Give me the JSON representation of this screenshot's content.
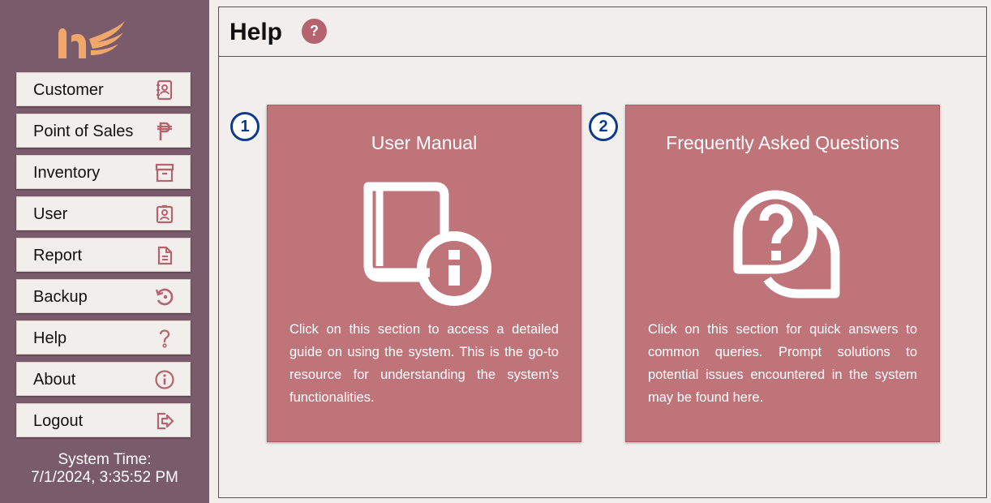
{
  "sidebar": {
    "logo_icon": "logo-icon",
    "items": [
      {
        "label": "Customer",
        "icon": "contact-book-icon"
      },
      {
        "label": "Point of Sales",
        "icon": "peso-icon"
      },
      {
        "label": "Inventory",
        "icon": "archive-box-icon"
      },
      {
        "label": "User",
        "icon": "user-badge-icon"
      },
      {
        "label": "Report",
        "icon": "document-icon"
      },
      {
        "label": "Backup",
        "icon": "history-icon"
      },
      {
        "label": "Help",
        "icon": "question-icon"
      },
      {
        "label": "About",
        "icon": "info-icon"
      },
      {
        "label": "Logout",
        "icon": "logout-icon"
      }
    ],
    "system_time_label": "System Time:",
    "system_time_value": "7/1/2024, 3:35:52 PM"
  },
  "header": {
    "title": "Help",
    "badge": "?"
  },
  "cards": [
    {
      "marker": "1",
      "title": "User Manual",
      "icon": "manual-book-icon",
      "description": "Click on this section to access a detailed guide on using the system. This is the go-to resource for understanding the system's functionalities."
    },
    {
      "marker": "2",
      "title": "Frequently Asked Questions",
      "icon": "faq-chat-icon",
      "description": "Click on this section for quick answers to common queries. Prompt solutions to potential issues encountered in the system may be found here."
    }
  ],
  "colors": {
    "sidebar": "#7a5b6c",
    "card": "#bf747a",
    "accent": "#b5636e",
    "marker": "#0d3b8c",
    "background": "#f1eeeb"
  }
}
